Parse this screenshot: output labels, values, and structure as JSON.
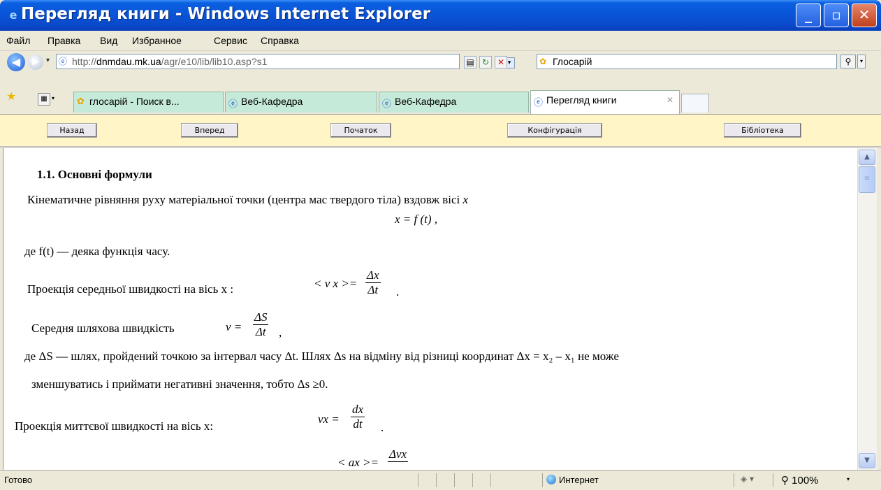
{
  "window": {
    "title": "Перегляд книги - Windows Internet Explorer"
  },
  "menu": [
    "Файл",
    "Правка",
    "Вид",
    "Избранное",
    "Сервис",
    "Справка"
  ],
  "address": {
    "url_prefix": "http://",
    "url_host": "dnmdau.mk.ua",
    "url_path": "/agr/e10/lib/lib10.asp?s1"
  },
  "search": {
    "value": "Глосарій"
  },
  "tabs": [
    {
      "label": "глосарій - Поиск в...",
      "active": false,
      "icon": "search-provider-icon"
    },
    {
      "label": "Веб-Кафедра",
      "active": false,
      "icon": "ie-page-icon"
    },
    {
      "label": "Веб-Кафедра",
      "active": false,
      "icon": "ie-page-icon"
    },
    {
      "label": "Перегляд книги",
      "active": true,
      "icon": "ie-page-icon"
    }
  ],
  "page_nav": [
    "Назад",
    "Вперед",
    "Початок",
    "Конфігурація",
    "Бібліотека"
  ],
  "content": {
    "heading": "1.1. Основні формули",
    "line1": "Кінематичне  рівняння   руху   матеріальної точки  (центра мас твердого тіла) вздовж вісі",
    "line1_var": "x",
    "eq1": "x = f (t) ,",
    "line2": "де f(t) — деяка функція часу.",
    "line3": "Проекція середньої швидкості на вісь x :",
    "eq2_lhs": "< ν x >=",
    "eq2_num": "Δx",
    "eq2_den": "Δt",
    "eq2_end": ".",
    "line4": "Середня шляхова швидкість",
    "eq3_lhs": "ν =",
    "eq3_num": "ΔS",
    "eq3_den": "Δt",
    "eq3_end": ",",
    "line5": "де ΔS — шлях, пройдений точкою за інтервал часу Δt. Шлях Δs  на відміну від різниці координат Δx = x₂ – x₁ не може",
    "line6": "зменшуватись і приймати негативні значення, тобто Δs ≥0.",
    "line7": "Проекція миттєвої швидкості на вісь  x:",
    "eq4_lhs": "νx =",
    "eq4_num": "dx",
    "eq4_den": "dt",
    "eq4_end": ".",
    "eq5_lhs": "< ax >=",
    "eq5_num": "Δνx"
  },
  "status": {
    "text": "Готово",
    "zone": "Интернет",
    "zoom": "100%"
  }
}
